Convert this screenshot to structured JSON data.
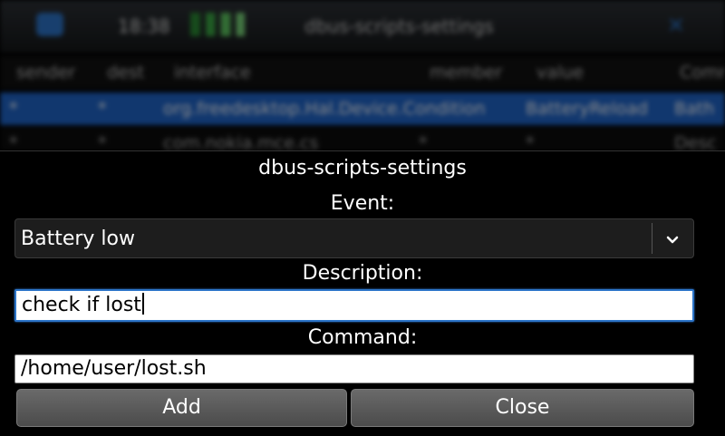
{
  "background": {
    "status_time": "18:38",
    "window_title": "dbus-scripts-settings",
    "columns": [
      "sender",
      "dest",
      "interface",
      "member",
      "value",
      "Comm"
    ],
    "row1": [
      "*",
      "*",
      "org.freedesktop.Hal.Device.Condition",
      "BatteryReload",
      "Bath"
    ],
    "row2": [
      "*",
      "*",
      "com.nokia.mce.cs",
      "*",
      "*",
      "Desc"
    ]
  },
  "dialog": {
    "title": "dbus-scripts-settings",
    "event_label": "Event:",
    "event_value": "Battery low",
    "description_label": "Description:",
    "description_value": "check if lost",
    "command_label": "Command:",
    "command_value": "/home/user/lost.sh",
    "add_label": "Add",
    "close_label": "Close"
  },
  "colors": {
    "accent": "#2c74c8",
    "dialog_bg": "#000000",
    "button": "#5a5a5a"
  }
}
